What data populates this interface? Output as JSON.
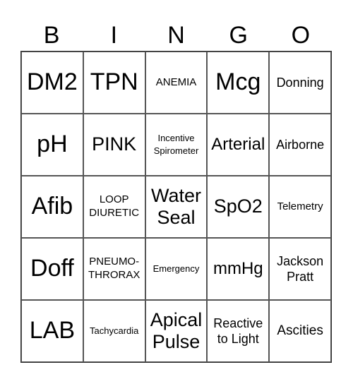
{
  "header": [
    "B",
    "I",
    "N",
    "G",
    "O"
  ],
  "cells": [
    [
      "DM2",
      "TPN",
      "ANEMIA",
      "Mcg",
      "Donning"
    ],
    [
      "pH",
      "PINK",
      "Incentive Spirometer",
      "Arterial",
      "Airborne"
    ],
    [
      "Afib",
      "LOOP DIURETIC",
      "Water Seal",
      "SpO2",
      "Telemetry"
    ],
    [
      "Doff",
      "PNEUMO-THRORAX",
      "Emergency",
      "mmHg",
      "Jackson Pratt"
    ],
    [
      "LAB",
      "Tachycardia",
      "Apical Pulse",
      "Reactive to Light",
      "Ascities"
    ]
  ]
}
